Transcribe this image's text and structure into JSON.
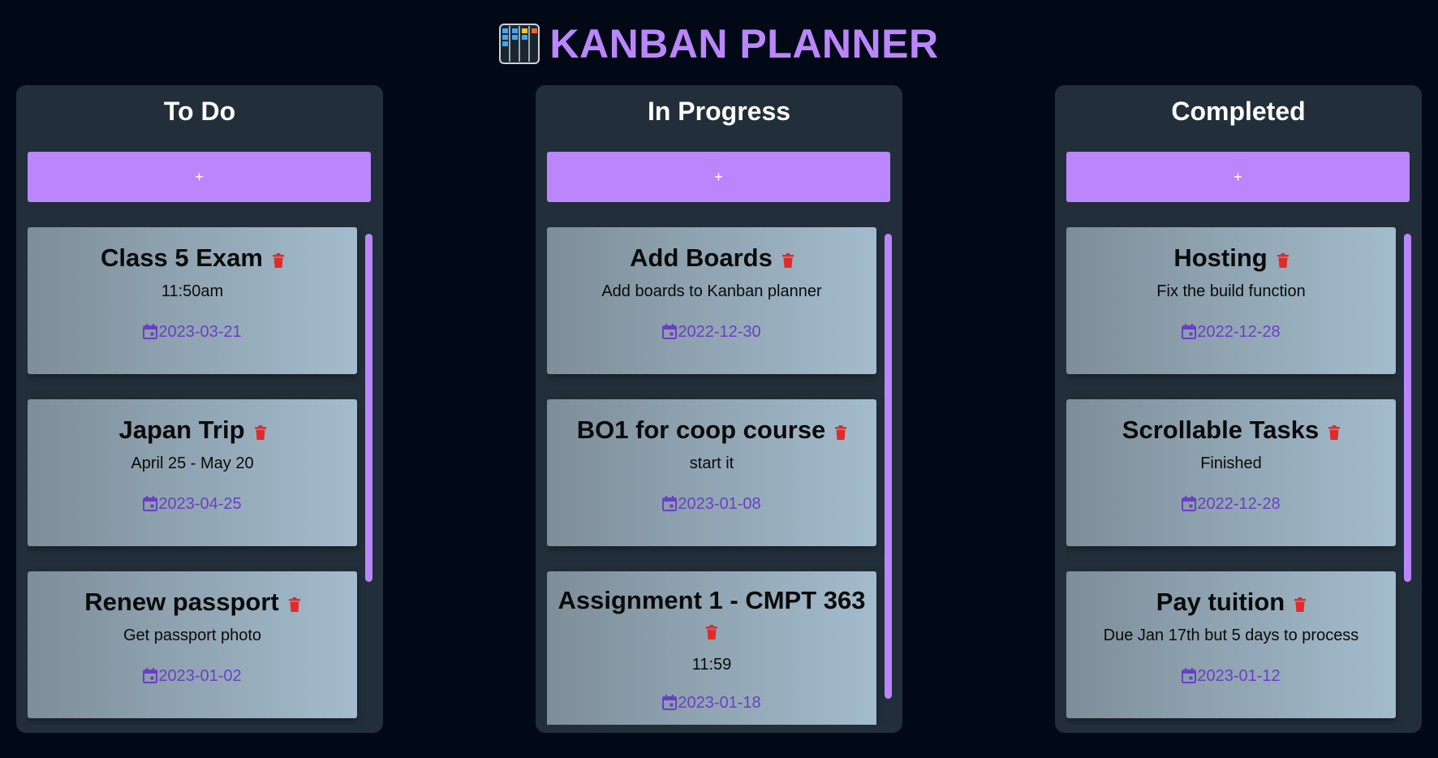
{
  "app": {
    "title": "KANBAN PLANNER",
    "icon": "kanban-board-icon",
    "accent_color": "#bb86fc",
    "date_color": "#6a3fc4",
    "delete_color": "#e02b2b"
  },
  "columns": [
    {
      "title": "To Do",
      "add_label": "+",
      "cards": [
        {
          "title": "Class 5 Exam",
          "desc": "11:50am",
          "date": "2023-03-21"
        },
        {
          "title": "Japan Trip",
          "desc": "April 25 - May 20",
          "date": "2023-04-25"
        },
        {
          "title": "Renew passport",
          "desc": "Get passport photo",
          "date": "2023-01-02"
        }
      ]
    },
    {
      "title": "In Progress",
      "add_label": "+",
      "cards": [
        {
          "title": "Add Boards",
          "desc": "Add boards to Kanban planner",
          "date": "2022-12-30"
        },
        {
          "title": "BO1 for coop course",
          "desc": "start it",
          "date": "2023-01-08"
        },
        {
          "title": "Assignment 1 - CMPT 363",
          "desc": "11:59",
          "date": "2023-01-18"
        }
      ]
    },
    {
      "title": "Completed",
      "add_label": "+",
      "cards": [
        {
          "title": "Hosting",
          "desc": "Fix the build function",
          "date": "2022-12-28"
        },
        {
          "title": "Scrollable Tasks",
          "desc": "Finished",
          "date": "2022-12-28"
        },
        {
          "title": "Pay tuition",
          "desc": "Due Jan 17th but 5 days to process",
          "date": "2023-01-12"
        }
      ]
    }
  ]
}
